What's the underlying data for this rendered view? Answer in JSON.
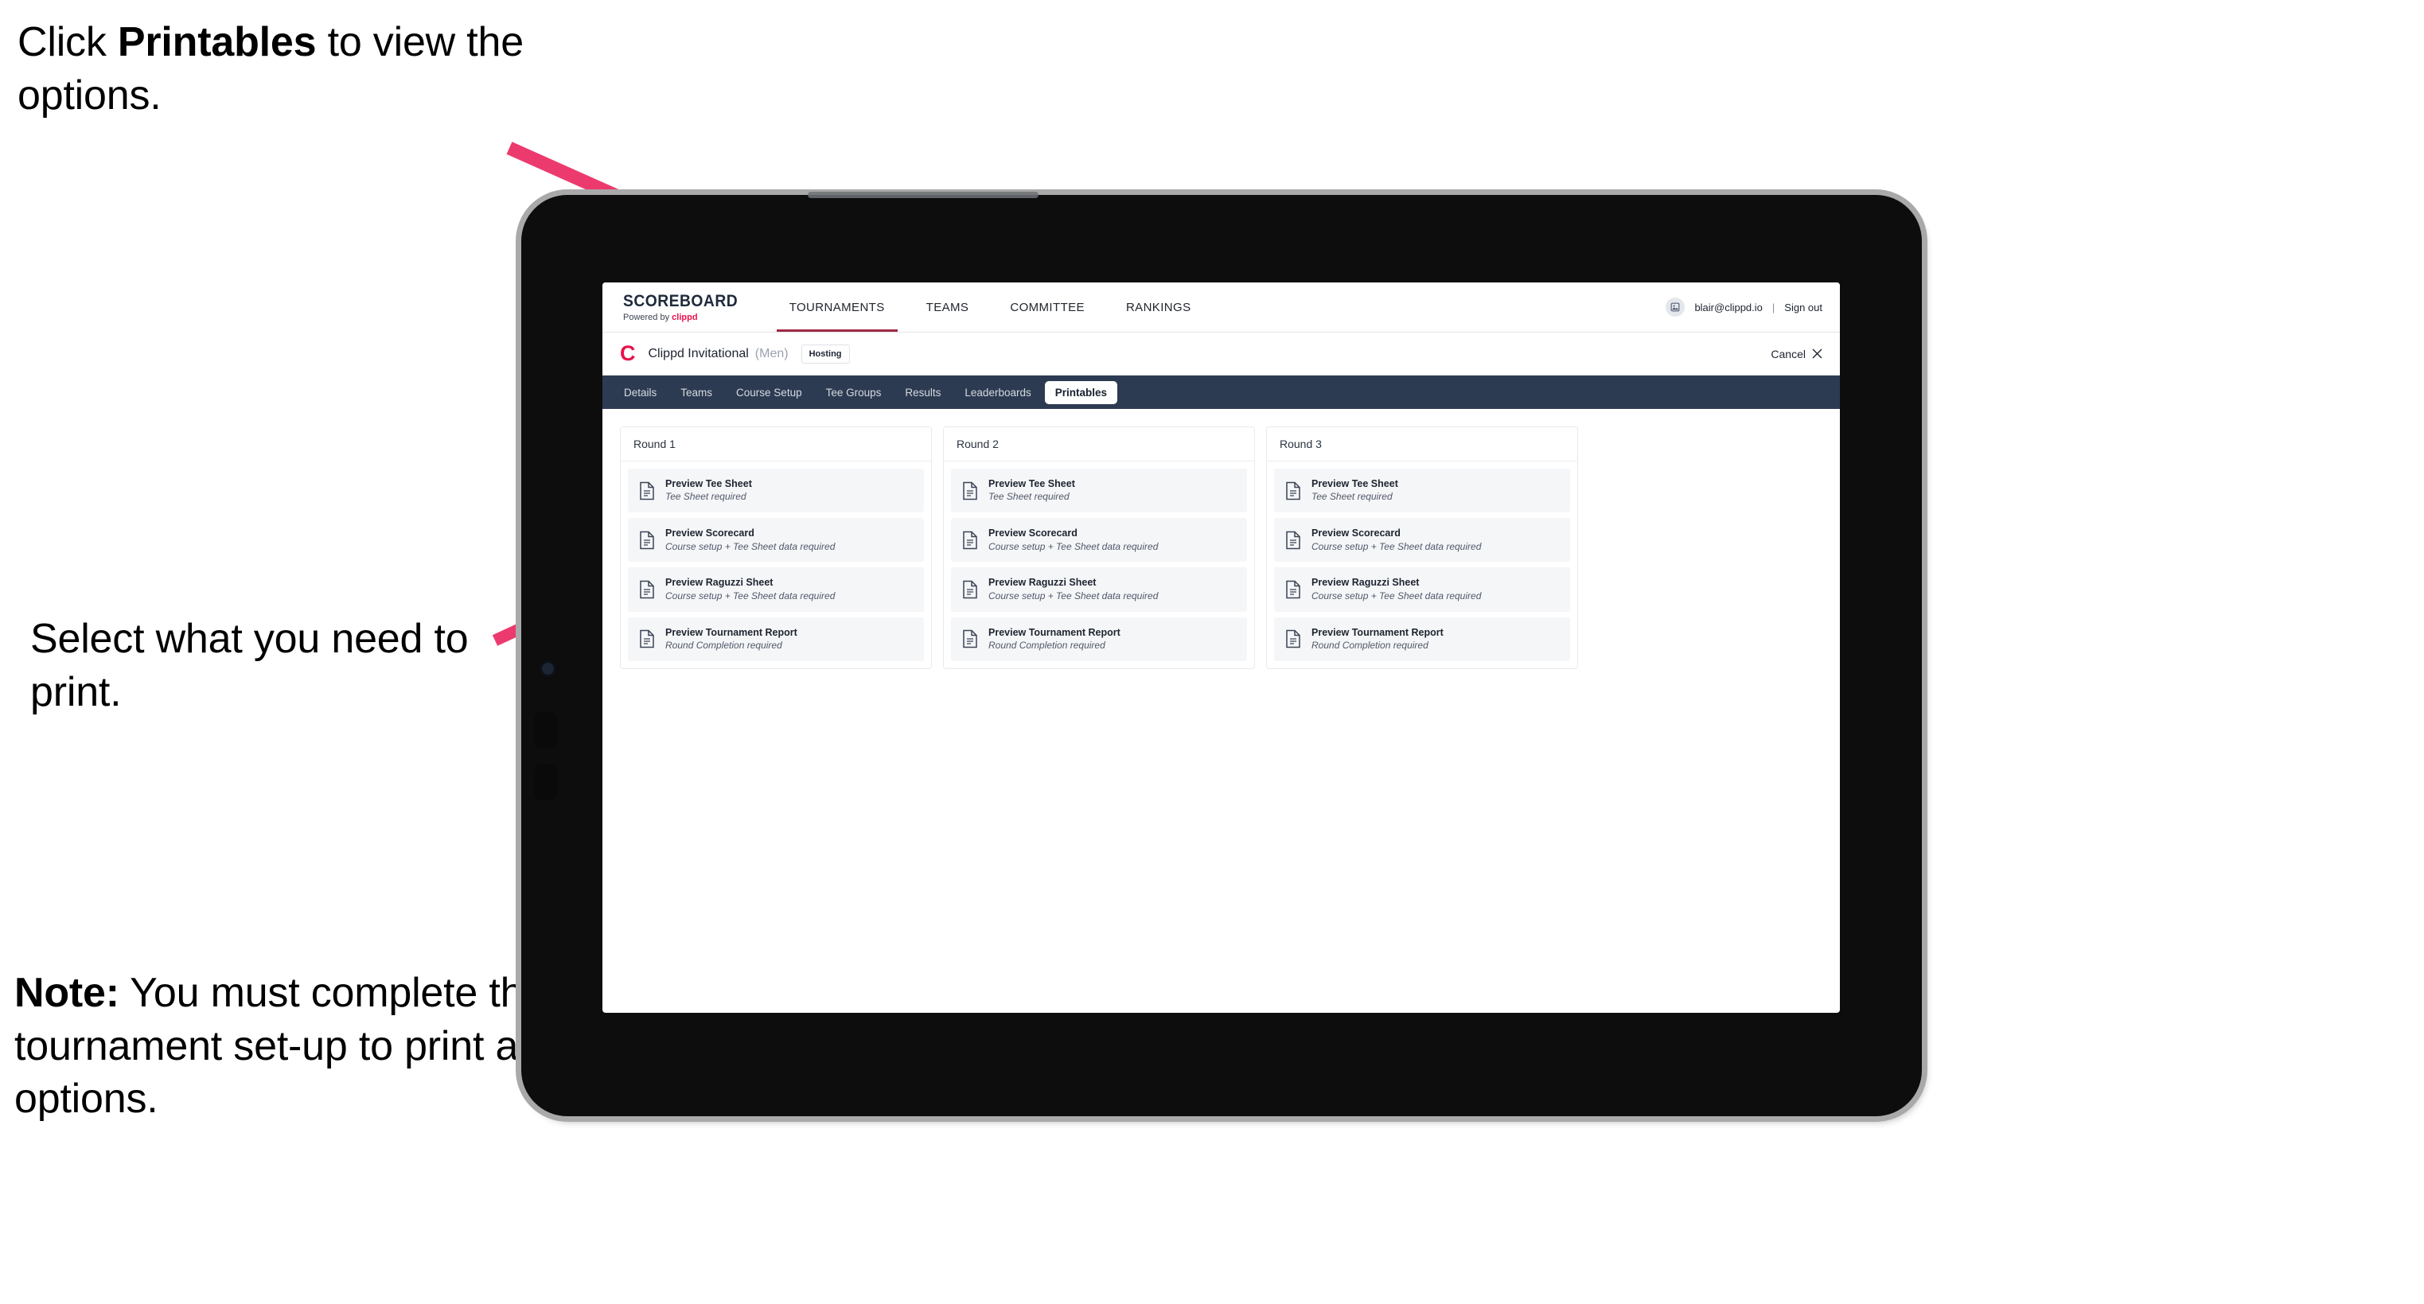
{
  "annotations": {
    "click_printables": {
      "before": "Click ",
      "bold": "Printables",
      "after": " to view the options."
    },
    "select_print": "Select what you need to print.",
    "note": {
      "bold": "Note:",
      "text": " You must complete the tournament set-up to print all the options."
    }
  },
  "app": {
    "brand": {
      "title": "SCOREBOARD",
      "powered_by_prefix": "Powered by ",
      "powered_by_brand": "clippd"
    },
    "top_nav": [
      {
        "label": "TOURNAMENTS",
        "active": true
      },
      {
        "label": "TEAMS",
        "active": false
      },
      {
        "label": "COMMITTEE",
        "active": false
      },
      {
        "label": "RANKINGS",
        "active": false
      }
    ],
    "account": {
      "avatar_icon": "user-avatar-icon",
      "email": "blair@clippd.io",
      "separator": "|",
      "sign_out": "Sign out"
    },
    "tournament_bar": {
      "logo_letter": "C",
      "name": "Clippd Invitational",
      "gender": "(Men)",
      "status_badge": "Hosting",
      "cancel_label": "Cancel",
      "cancel_icon": "close-x-icon"
    },
    "tabs": [
      {
        "label": "Details",
        "active": false
      },
      {
        "label": "Teams",
        "active": false
      },
      {
        "label": "Course Setup",
        "active": false
      },
      {
        "label": "Tee Groups",
        "active": false
      },
      {
        "label": "Results",
        "active": false
      },
      {
        "label": "Leaderboards",
        "active": false
      },
      {
        "label": "Printables",
        "active": true
      }
    ],
    "rounds": [
      {
        "header": "Round 1",
        "items": [
          {
            "title": "Preview Tee Sheet",
            "subtitle": "Tee Sheet required",
            "icon": "document-icon"
          },
          {
            "title": "Preview Scorecard",
            "subtitle": "Course setup + Tee Sheet data required",
            "icon": "document-icon"
          },
          {
            "title": "Preview Raguzzi Sheet",
            "subtitle": "Course setup + Tee Sheet data required",
            "icon": "document-icon"
          },
          {
            "title": "Preview Tournament Report",
            "subtitle": "Round Completion required",
            "icon": "document-icon"
          }
        ]
      },
      {
        "header": "Round 2",
        "items": [
          {
            "title": "Preview Tee Sheet",
            "subtitle": "Tee Sheet required",
            "icon": "document-icon"
          },
          {
            "title": "Preview Scorecard",
            "subtitle": "Course setup + Tee Sheet data required",
            "icon": "document-icon"
          },
          {
            "title": "Preview Raguzzi Sheet",
            "subtitle": "Course setup + Tee Sheet data required",
            "icon": "document-icon"
          },
          {
            "title": "Preview Tournament Report",
            "subtitle": "Round Completion required",
            "icon": "document-icon"
          }
        ]
      },
      {
        "header": "Round 3",
        "items": [
          {
            "title": "Preview Tee Sheet",
            "subtitle": "Tee Sheet required",
            "icon": "document-icon"
          },
          {
            "title": "Preview Scorecard",
            "subtitle": "Course setup + Tee Sheet data required",
            "icon": "document-icon"
          },
          {
            "title": "Preview Raguzzi Sheet",
            "subtitle": "Course setup + Tee Sheet data required",
            "icon": "document-icon"
          },
          {
            "title": "Preview Tournament Report",
            "subtitle": "Round Completion required",
            "icon": "document-icon"
          }
        ]
      }
    ]
  },
  "colors": {
    "accent_pink": "#ec3a6e",
    "brand_red": "#e8114b",
    "tab_strip": "#2d3b52",
    "active_underline": "#9e2b46",
    "card_bg": "#f5f6f8"
  }
}
